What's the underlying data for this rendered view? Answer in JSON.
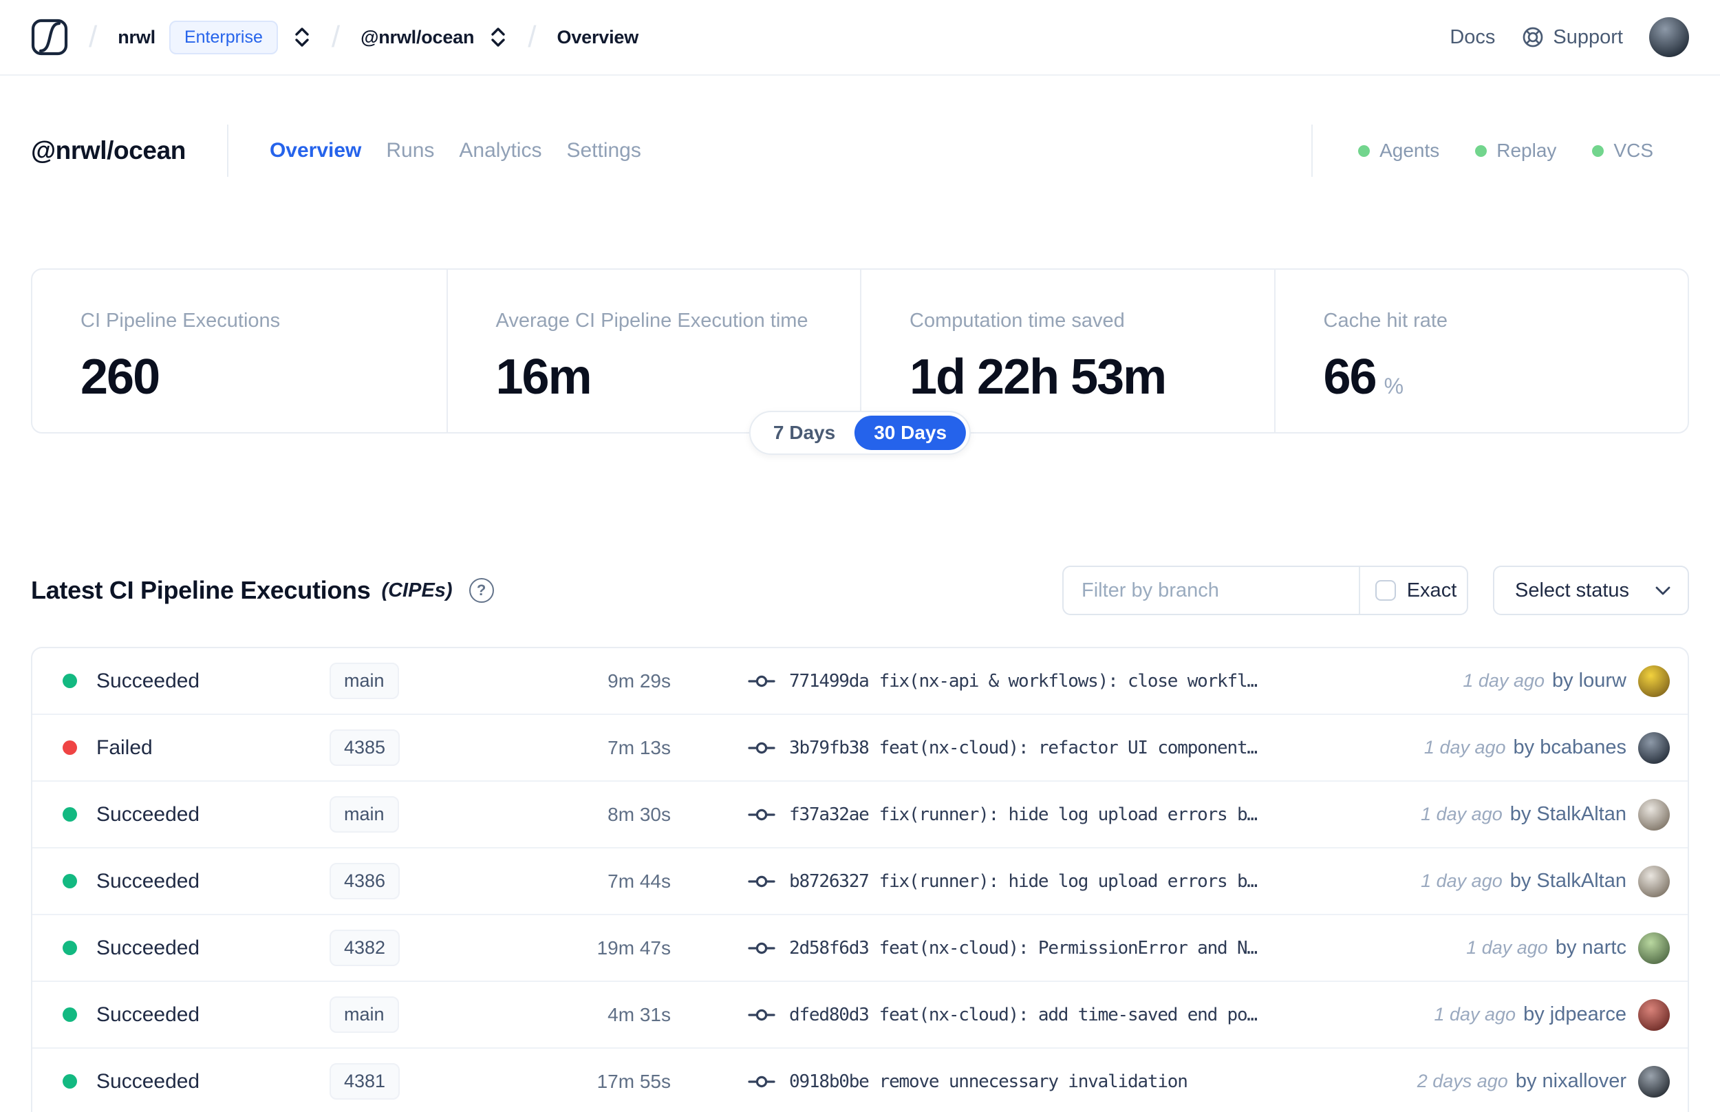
{
  "colors": {
    "accent": "#2563eb",
    "succeeded": "#13b981",
    "failed": "#ef4444",
    "service_dot": "#72d58d"
  },
  "header": {
    "breadcrumb": {
      "org": "nrwl",
      "org_badge": "Enterprise",
      "workspace": "@nrwl/ocean",
      "page": "Overview"
    },
    "nav": {
      "docs": "Docs",
      "support": "Support"
    }
  },
  "workspace": {
    "title": "@nrwl/ocean",
    "tabs": [
      {
        "label": "Overview",
        "active": true
      },
      {
        "label": "Runs"
      },
      {
        "label": "Analytics"
      },
      {
        "label": "Settings"
      }
    ],
    "services": [
      {
        "label": "Agents"
      },
      {
        "label": "Replay"
      },
      {
        "label": "VCS"
      }
    ]
  },
  "stats": {
    "cards": [
      {
        "label": "CI Pipeline Executions",
        "value": "260"
      },
      {
        "label": "Average CI Pipeline Execution time",
        "value": "16m"
      },
      {
        "label": "Computation time saved",
        "value": "1d 22h 53m"
      },
      {
        "label": "Cache hit rate",
        "value": "66",
        "suffix": "%"
      }
    ],
    "range_toggle": {
      "options": [
        {
          "label": "7 Days"
        },
        {
          "label": "30 Days",
          "active": true
        }
      ],
      "selected": "30 Days"
    }
  },
  "cipe": {
    "title": "Latest CI Pipeline Executions",
    "title_suffix": "(CIPEs)",
    "help_glyph": "?",
    "filter_placeholder": "Filter by branch",
    "exact_label": "Exact",
    "select_status_label": "Select status"
  },
  "table": {
    "rows": [
      {
        "status": "Succeeded",
        "branch": "main",
        "duration": "9m 29s",
        "commit_hash": "771499da",
        "commit_message": "fix(nx-api & workflows): close workfl…",
        "time": "1 day ago",
        "author": "by lourw",
        "avatar_colors": [
          "#f2d23e",
          "#8a6d1f"
        ]
      },
      {
        "status": "Failed",
        "failed": true,
        "branch": "4385",
        "duration": "7m 13s",
        "commit_hash": "3b79fb38",
        "commit_message": "feat(nx-cloud): refactor UI component…",
        "time": "1 day ago",
        "author": "by bcabanes",
        "avatar_colors": [
          "#8d99a8",
          "#2b3440"
        ]
      },
      {
        "status": "Succeeded",
        "branch": "main",
        "duration": "8m 30s",
        "commit_hash": "f37a32ae",
        "commit_message": "fix(runner): hide log upload errors b…",
        "time": "1 day ago",
        "author": "by StalkAltan",
        "avatar_colors": [
          "#e9e5df",
          "#847a6d"
        ]
      },
      {
        "status": "Succeeded",
        "branch": "4386",
        "duration": "7m 44s",
        "commit_hash": "b8726327",
        "commit_message": "fix(runner): hide log upload errors b…",
        "time": "1 day ago",
        "author": "by StalkAltan",
        "avatar_colors": [
          "#e9e5df",
          "#847a6d"
        ]
      },
      {
        "status": "Succeeded",
        "branch": "4382",
        "duration": "19m 47s",
        "commit_hash": "2d58f6d3",
        "commit_message": "feat(nx-cloud): PermissionError and N…",
        "time": "1 day ago",
        "author": "by nartc",
        "avatar_colors": [
          "#b9d8a0",
          "#56704a"
        ]
      },
      {
        "status": "Succeeded",
        "branch": "main",
        "duration": "4m 31s",
        "commit_hash": "dfed80d3",
        "commit_message": "feat(nx-cloud): add time-saved end po…",
        "time": "1 day ago",
        "author": "by jdpearce",
        "avatar_colors": [
          "#d9837a",
          "#73302b"
        ]
      },
      {
        "status": "Succeeded",
        "branch": "4381",
        "duration": "17m 55s",
        "commit_hash": "0918b0be",
        "commit_message": "remove unnecessary invalidation",
        "time": "2 days ago",
        "author": "by nixallover",
        "avatar_colors": [
          "#9aa3ad",
          "#2d333a"
        ]
      }
    ]
  }
}
